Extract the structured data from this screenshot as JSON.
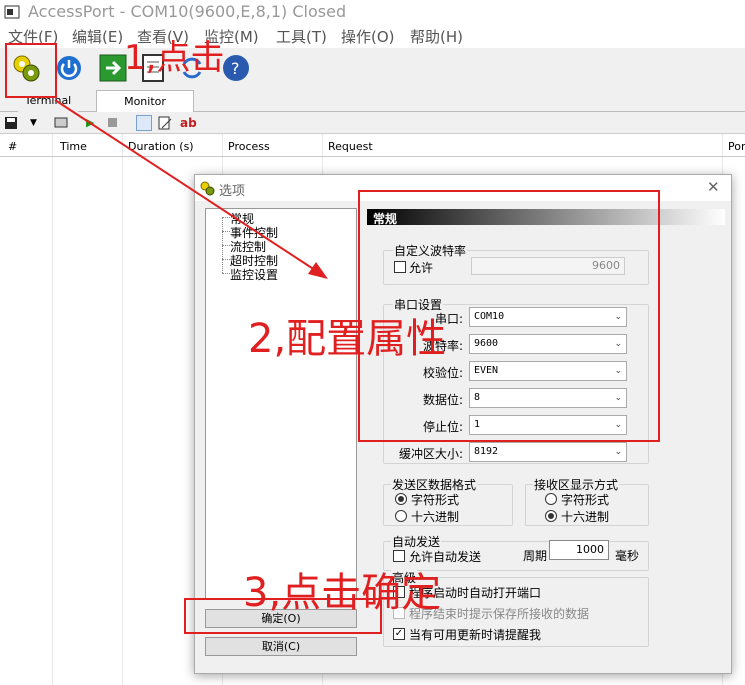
{
  "window": {
    "title": "AccessPort - COM10(9600,E,8,1) Closed"
  },
  "menu": [
    {
      "label": "文件(F)"
    },
    {
      "label": "编辑(E)"
    },
    {
      "label": "查看(V)"
    },
    {
      "label": "监控(M)"
    },
    {
      "label": "工具(T)"
    },
    {
      "label": "操作(O)"
    },
    {
      "label": "帮助(H)"
    }
  ],
  "tabs": [
    {
      "label": "Terminal"
    },
    {
      "label": "Monitor"
    }
  ],
  "toolbar2": {
    "ab_label": "ab"
  },
  "grid_columns": [
    "#",
    "Time",
    "Duration (s)",
    "Process",
    "Request",
    "Por"
  ],
  "dialog": {
    "title": "选项",
    "tree": [
      "常规",
      "事件控制",
      "流控制",
      "超时控制",
      "监控设置"
    ],
    "ok": "确定(O)",
    "cancel": "取消(C)",
    "panel_header": "常规",
    "custom_baud": {
      "group": "自定义波特率",
      "allow": "允许",
      "value": "9600"
    },
    "serial": {
      "group": "串口设置",
      "port_label": "串口:",
      "port": "COM10",
      "baud_label": "波特率:",
      "baud": "9600",
      "parity_label": "校验位:",
      "parity": "EVEN",
      "databits_label": "数据位:",
      "databits": "8",
      "stopbits_label": "停止位:",
      "stopbits": "1",
      "buffer_label": "缓冲区大小:",
      "buffer": "8192"
    },
    "send_format": {
      "group": "发送区数据格式",
      "opt1": "字符形式",
      "opt2": "十六进制",
      "selected": "字符形式"
    },
    "recv_format": {
      "group": "接收区显示方式",
      "opt1": "字符形式",
      "opt2": "十六进制",
      "selected": "十六进制"
    },
    "auto_send": {
      "group": "自动发送",
      "allow": "允许自动发送",
      "period_label": "周期",
      "period": "1000",
      "unit": "毫秒"
    },
    "advanced": {
      "group": "高级",
      "opt1": "程序启动时自动打开端口",
      "opt2": "程序结束时提示保存所接收的数据",
      "opt3": "当有可用更新时请提醒我"
    }
  },
  "annotations": {
    "step1": "1,点击",
    "step2": "2,配置属性",
    "step3": "3,点击确定"
  },
  "colors": {
    "annotation": "#e02020",
    "header_gradient_start": "#000000",
    "header_gradient_end": "#ffffff"
  }
}
